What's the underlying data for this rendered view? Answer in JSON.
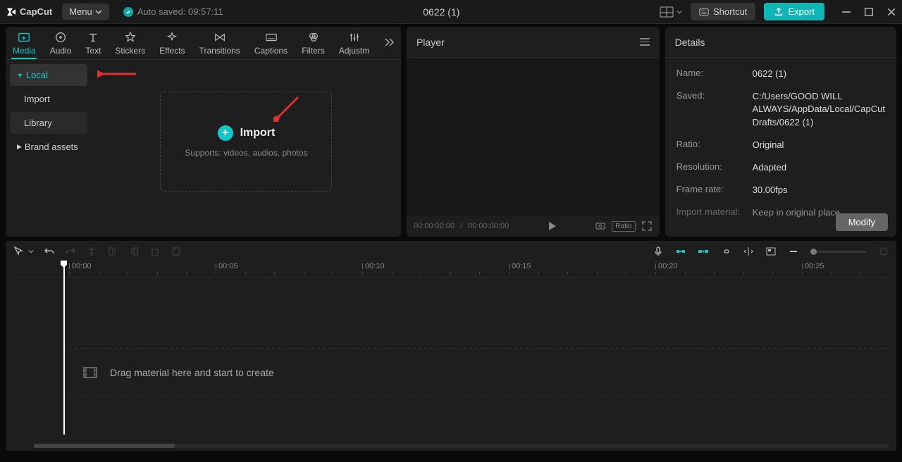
{
  "titlebar": {
    "logo_text": "CapCut",
    "menu_label": "Menu",
    "autosave_text": "Auto saved: 09:57:11",
    "project_title": "0622 (1)",
    "shortcut_label": "Shortcut",
    "export_label": "Export"
  },
  "media_tabs": [
    "Media",
    "Audio",
    "Text",
    "Stickers",
    "Effects",
    "Transitions",
    "Captions",
    "Filters",
    "Adjustm"
  ],
  "sidebar": {
    "items": [
      {
        "label": "Local",
        "expanded": true,
        "selected": true
      },
      {
        "label": "Import"
      },
      {
        "label": "Library",
        "alt": true
      },
      {
        "label": "Brand assets",
        "hasChildren": true
      }
    ]
  },
  "import_box": {
    "label": "Import",
    "subtitle": "Supports: videos, audios, photos"
  },
  "player": {
    "title": "Player",
    "time_current": "00:00:00:00",
    "time_divider": "/",
    "time_total": "00:00:00:00",
    "ratio_tag": "Ratio"
  },
  "details": {
    "title": "Details",
    "modify_label": "Modify",
    "rows": [
      {
        "label": "Name:",
        "value": "0622 (1)"
      },
      {
        "label": "Saved:",
        "value": "C:/Users/GOOD WILL ALWAYS/AppData/Local/CapCut Drafts/0622 (1)"
      },
      {
        "label": "Ratio:",
        "value": "Original"
      },
      {
        "label": "Resolution:",
        "value": "Adapted"
      },
      {
        "label": "Frame rate:",
        "value": "30.00fps"
      },
      {
        "label": "Import material:",
        "value": "Keep in original place"
      }
    ]
  },
  "timeline": {
    "ticks": [
      "00:00",
      "00:05",
      "00:10",
      "00:15",
      "00:20",
      "00:25"
    ],
    "drag_hint": "Drag material here and start to create"
  }
}
